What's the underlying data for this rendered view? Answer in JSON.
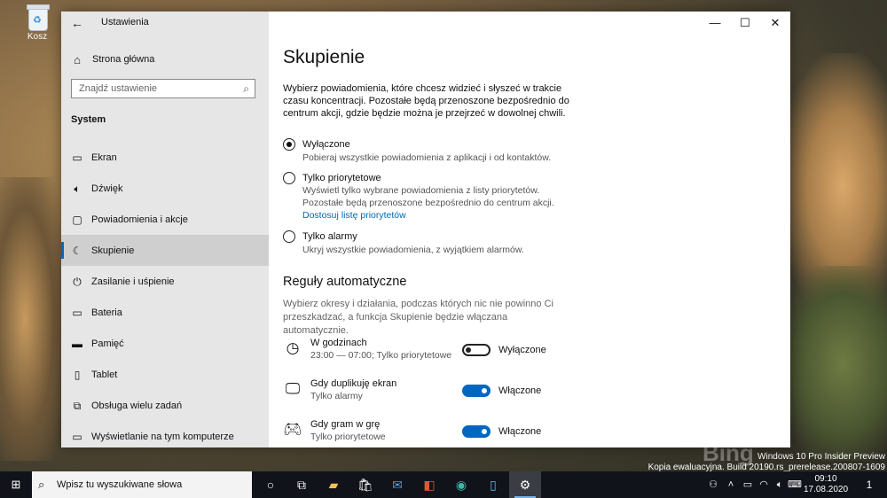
{
  "desktop": {
    "recycle_bin_label": "Kosz",
    "watermark_line1": "Windows 10 Pro Insider Preview",
    "watermark_line2": "Kopia ewaluacyjna. Build 20190.rs_prerelease.200807-1609"
  },
  "window": {
    "title": "Ustawienia",
    "minimize_icon": "minimize-icon",
    "maximize_icon": "maximize-icon",
    "close_icon": "close-icon"
  },
  "sidebar": {
    "home_label": "Strona główna",
    "search_placeholder": "Znajdź ustawienie",
    "section_title": "System",
    "items": [
      {
        "label": "Ekran",
        "icon": "display-icon"
      },
      {
        "label": "Dźwięk",
        "icon": "sound-icon"
      },
      {
        "label": "Powiadomienia i akcje",
        "icon": "notifications-icon"
      },
      {
        "label": "Skupienie",
        "icon": "moon-icon",
        "active": true
      },
      {
        "label": "Zasilanie i uśpienie",
        "icon": "power-icon"
      },
      {
        "label": "Bateria",
        "icon": "battery-icon"
      },
      {
        "label": "Pamięć",
        "icon": "storage-icon"
      },
      {
        "label": "Tablet",
        "icon": "tablet-icon"
      },
      {
        "label": "Obsługa wielu zadań",
        "icon": "multitasking-icon"
      },
      {
        "label": "Wyświetlanie na tym komputerze",
        "icon": "project-icon"
      }
    ]
  },
  "main": {
    "title": "Skupienie",
    "description": "Wybierz powiadomienia, które chcesz widzieć i słyszeć w trakcie czasu koncentracji. Pozostałe będą przenoszone bezpośrednio do centrum akcji, gdzie będzie można je przejrzeć w dowolnej chwili.",
    "options": [
      {
        "title": "Wyłączone",
        "desc": "Pobieraj wszystkie powiadomienia z aplikacji i od kontaktów.",
        "checked": true
      },
      {
        "title": "Tylko priorytetowe",
        "desc": "Wyświetl tylko wybrane powiadomienia z listy priorytetów.",
        "desc2": "Pozostałe będą przenoszone bezpośrednio do centrum akcji.",
        "link": "Dostosuj listę priorytetów",
        "checked": false
      },
      {
        "title": "Tylko alarmy",
        "desc": "Ukryj wszystkie powiadomienia, z wyjątkiem alarmów.",
        "checked": false
      }
    ],
    "rules_title": "Reguły automatyczne",
    "rules_description": "Wybierz okresy i działania, podczas których nic nie powinno Ci przeszkadzać, a funkcja Skupienie będzie włączana automatycznie.",
    "rules": [
      {
        "title": "W godzinach",
        "sub": "23:00 — 07:00; Tylko priorytetowe",
        "toggle": "Wyłączone",
        "on": false
      },
      {
        "title": "Gdy duplikuję ekran",
        "sub": "Tylko alarmy",
        "toggle": "Włączone",
        "on": true
      },
      {
        "title": "Gdy gram w grę",
        "sub": "Tylko priorytetowe",
        "toggle": "Włączone",
        "on": true
      }
    ]
  },
  "taskbar": {
    "search_placeholder": "Wpisz tu wyszukiwane słowa",
    "time": "09:10",
    "date": "17.08.2020",
    "notification_count": "1"
  }
}
